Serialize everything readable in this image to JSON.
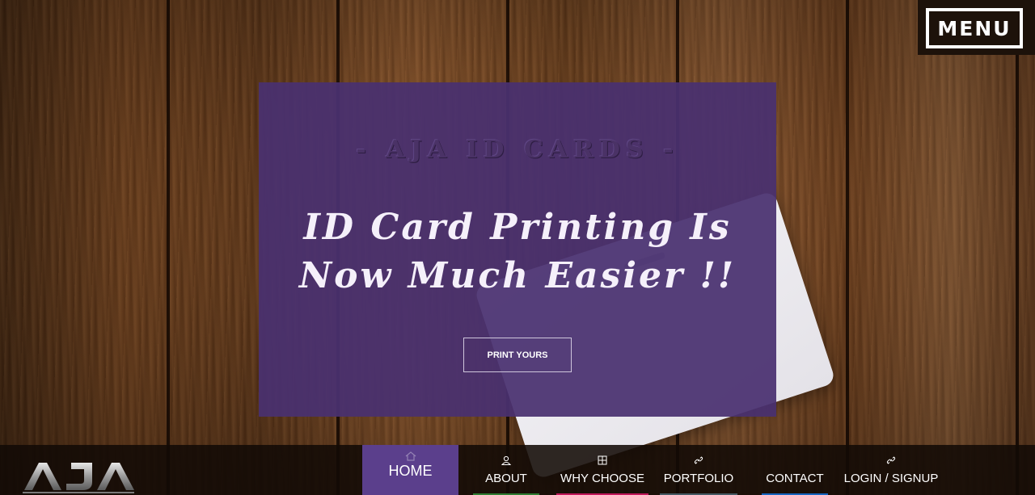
{
  "menu": {
    "label": "MENU"
  },
  "hero": {
    "brand": "- AJA ID CARDS -",
    "headline_line1": "ID Card Printing Is",
    "headline_line2": "Now Much Easier !!",
    "cta_label": "PRINT YOURS"
  },
  "logo": {
    "text": "AJA"
  },
  "nav": {
    "items": [
      {
        "label": "HOME",
        "icon": "home-icon"
      },
      {
        "label": "ABOUT",
        "icon": "user-icon"
      },
      {
        "label": "WHY CHOOSE",
        "icon": "grid-icon"
      },
      {
        "label": "PORTFOLIO",
        "icon": "link-icon"
      },
      {
        "label": "CONTACT",
        "icon": "phone-icon"
      },
      {
        "label": "LOGIN / SIGNUP",
        "icon": "link-icon"
      }
    ]
  },
  "colors": {
    "panel": "#493070",
    "nav_active": "#5b3f8c",
    "navbar": "#120a06",
    "accent_strips": [
      "#2e7d32",
      "#c2185b",
      "#455a64",
      "#1565c0"
    ]
  }
}
